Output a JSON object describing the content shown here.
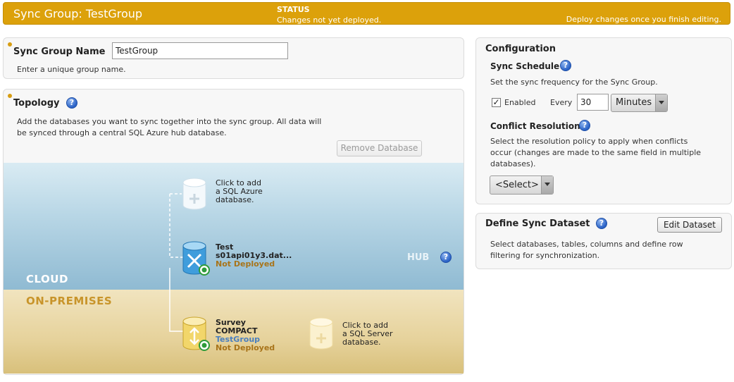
{
  "header": {
    "title": "Sync Group:  TestGroup",
    "status_label": "STATUS",
    "status_text": "Changes not yet deployed.",
    "status_hint": "Deploy changes once you finish editing."
  },
  "name_section": {
    "label": "Sync Group Name",
    "value": "TestGroup",
    "hint": "Enter a unique group name."
  },
  "topology": {
    "title": "Topology",
    "description_line1": "Add the databases you want to sync together into the sync group. All data will",
    "description_line2": "be synced through a central SQL Azure hub database.",
    "remove_button": "Remove Database",
    "cloud_label": "CLOUD",
    "onprem_label": "ON-PREMISES",
    "hub_label": "HUB",
    "add_azure": [
      "Click to add",
      "a SQL Azure",
      "database."
    ],
    "hub_db": {
      "name": "Test",
      "server": "s01api01y3.dat...",
      "status": "Not Deployed"
    },
    "member_db": {
      "name": "Survey",
      "subname": "COMPACT",
      "group": "TestGroup",
      "status": "Not Deployed"
    },
    "add_sqlserver": [
      "Click to add",
      "a SQL Server",
      "database."
    ]
  },
  "configuration": {
    "title": "Configuration",
    "schedule_title": "Sync Schedule",
    "schedule_desc": "Set the sync frequency for the Sync Group.",
    "enabled_label": "Enabled",
    "enabled_checked": true,
    "every_label": "Every",
    "every_value": "30",
    "unit_value": "Minutes",
    "conflict_title": "Conflict Resolution",
    "conflict_desc_line1": "Select the resolution policy to apply when conflicts",
    "conflict_desc_line2": "occur (changes are made to the same field in multiple",
    "conflict_desc_line3": "databases).",
    "conflict_select": "<Select>"
  },
  "dataset": {
    "title": "Define Sync Dataset",
    "edit_button": "Edit Dataset",
    "desc_line1": "Select databases, tables, columns and define row",
    "desc_line2": "filtering for synchronization."
  },
  "help_glyph": "?",
  "colors": {
    "header": "#dca10b",
    "cloud": "#8fbad2",
    "onprem": "#e6d29b",
    "not_deployed": "#a8741a",
    "help_icon": "#2a62c6"
  }
}
